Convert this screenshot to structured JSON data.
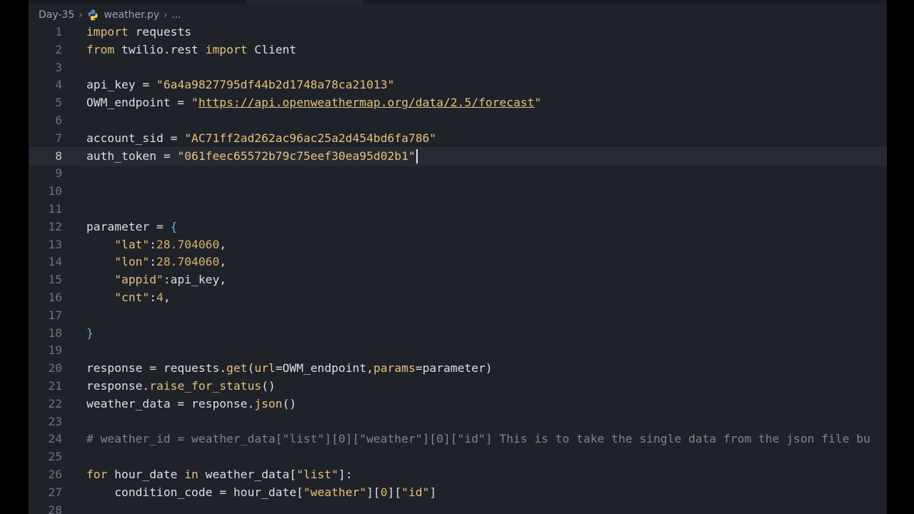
{
  "breadcrumb": {
    "folder": "Day-35",
    "file": "weather.py",
    "more": "..."
  },
  "editor": {
    "current_line": 8,
    "lines": [
      {
        "n": "1",
        "t": "import requests"
      },
      {
        "n": "2",
        "t": "from twilio.rest import Client"
      },
      {
        "n": "3",
        "t": ""
      },
      {
        "n": "4",
        "t": "api_key = \"6a4a9827795df44b2d1748a78ca21013\""
      },
      {
        "n": "5",
        "t": "OWM_endpoint = \"https://api.openweathermap.org/data/2.5/forecast\""
      },
      {
        "n": "6",
        "t": ""
      },
      {
        "n": "7",
        "t": "account_sid = \"AC71ff2ad262ac96ac25a2d454bd6fa786\""
      },
      {
        "n": "8",
        "t": "auth_token = \"061feec65572b79c75eef30ea95d02b1\""
      },
      {
        "n": "9",
        "t": ""
      },
      {
        "n": "10",
        "t": ""
      },
      {
        "n": "11",
        "t": ""
      },
      {
        "n": "12",
        "t": "parameter = {"
      },
      {
        "n": "13",
        "t": "    \"lat\":28.704060,"
      },
      {
        "n": "14",
        "t": "    \"lon\":28.704060,"
      },
      {
        "n": "15",
        "t": "    \"appid\":api_key,"
      },
      {
        "n": "16",
        "t": "    \"cnt\":4,"
      },
      {
        "n": "17",
        "t": ""
      },
      {
        "n": "18",
        "t": "}"
      },
      {
        "n": "19",
        "t": ""
      },
      {
        "n": "20",
        "t": "response = requests.get(url=OWM_endpoint,params=parameter)"
      },
      {
        "n": "21",
        "t": "response.raise_for_status()"
      },
      {
        "n": "22",
        "t": "weather_data = response.json()"
      },
      {
        "n": "23",
        "t": ""
      },
      {
        "n": "24",
        "t": "# weather_id = weather_data[\"list\"][0][\"weather\"][0][\"id\"] This is to take the single data from the json file bu"
      },
      {
        "n": "25",
        "t": ""
      },
      {
        "n": "26",
        "t": "for hour_date in weather_data[\"list\"]:"
      },
      {
        "n": "27",
        "t": "    condition_code = hour_date[\"weather\"][0][\"id\"]"
      },
      {
        "n": "28",
        "t": ""
      }
    ]
  },
  "colors": {
    "background": "#1f2229",
    "keyword": "#e5c07b",
    "string": "#e6c07b",
    "brace": "#61aff0",
    "comment": "#7f848e",
    "text": "#dcdfe4"
  },
  "icons": {
    "file_icon": "python-file-icon",
    "separator": "chevron-right-icon"
  }
}
